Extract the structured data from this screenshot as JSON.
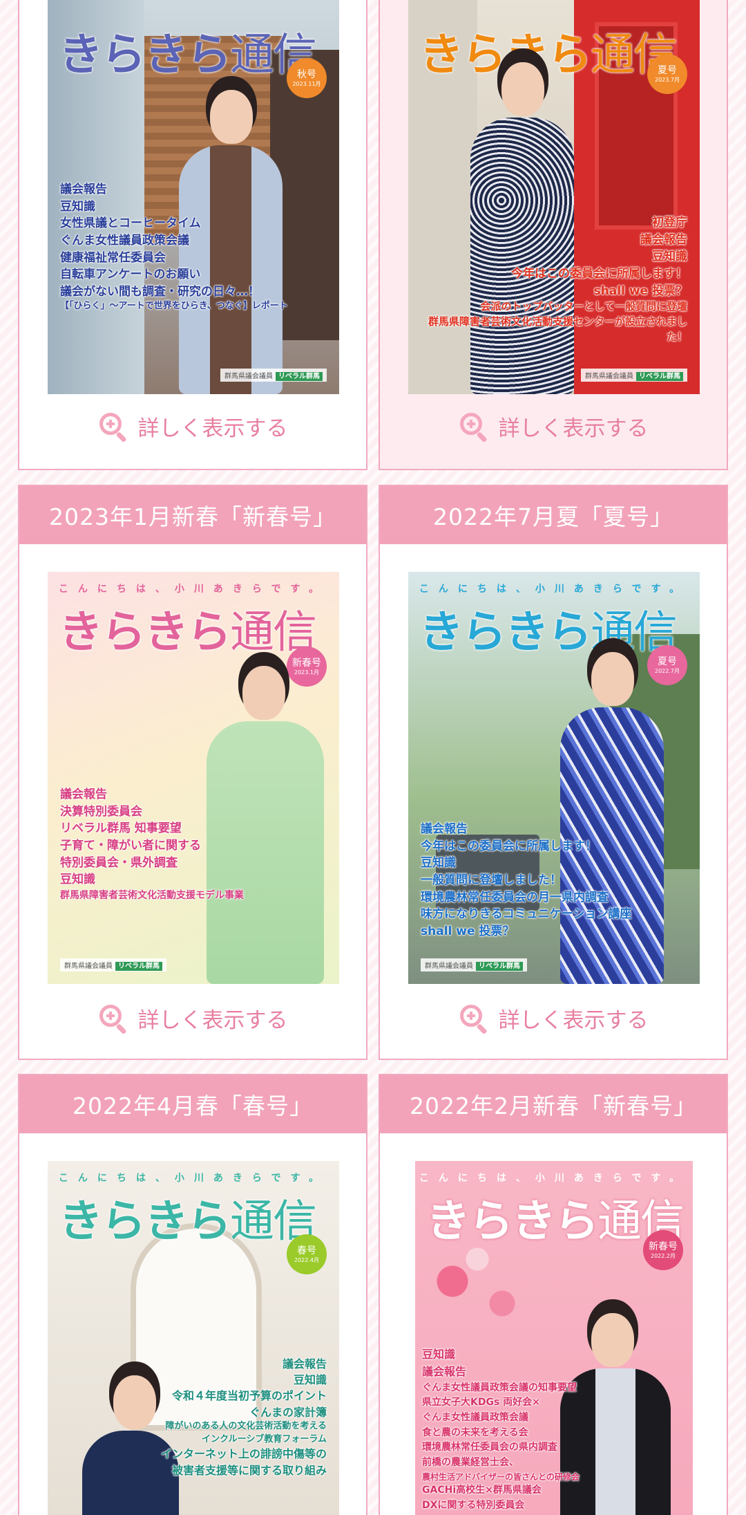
{
  "common": {
    "detail_label": "詳しく表示する",
    "series_top": "こんにちは、小川あきらです。",
    "brand_a": "きらきら",
    "brand_b": "通信",
    "footer_org": "群馬県議会議員",
    "footer_party": "リベラル群馬"
  },
  "colors": {
    "header_bg": "#f2a3ba",
    "card_border": "#f2a9c0",
    "link_text": "#e87fa0"
  },
  "issues": [
    {
      "title": "",
      "badge": "秋号",
      "badge_date": "2023.11月",
      "headlines": [
        "議会報告",
        "豆知識",
        "女性県議とコーヒータイム",
        "ぐんま女性議員政策会議",
        "健康福祉常任委員会",
        "自転車アンケートのお願い",
        "議会がない間も調査・研究の日々…！",
        "【「ひらく」〜アートで世界をひらき、つなぐ】レポート"
      ]
    },
    {
      "title": "",
      "badge": "夏号",
      "badge_date": "2023.7月",
      "headlines": [
        "初登庁",
        "議会報告",
        "豆知識",
        "今年はこの委員会に所属します！",
        "shall we 投票？",
        "会派のトップバッターとして一般質問に登壇",
        "群馬県障害者芸術文化活動支援センターが設立されました！"
      ]
    },
    {
      "title": "2023年1月新春「新春号」",
      "badge": "新春号",
      "badge_date": "2023.1月",
      "headlines": [
        "議会報告",
        "決算特別委員会",
        "リベラル群馬 知事要望",
        "子育て・障がい者に関する",
        "特別委員会・県外調査",
        "豆知識",
        "群馬県障害者芸術文化活動支援モデル事業"
      ]
    },
    {
      "title": "2022年7月夏「夏号」",
      "badge": "夏号",
      "badge_date": "2022.7月",
      "headlines": [
        "議会報告",
        "今年はこの委員会に所属します！",
        "豆知識",
        "一般質問に登壇しました！",
        "環境農林常任委員会の月一県内調査",
        "味方になりきるコミュニケーション講座",
        "shall we 投票？"
      ]
    },
    {
      "title": "2022年4月春「春号」",
      "badge": "春号",
      "badge_date": "2022.4月",
      "headlines": [
        "議会報告",
        "豆知識",
        "令和４年度当初予算のポイント",
        "ぐんまの家計簿",
        "障がいのある人の文化芸術活動を考える",
        "インクルーシブ教育フォーラム",
        "インターネット上の誹謗中傷等の",
        "被害者支援等に関する取り組み"
      ]
    },
    {
      "title": "2022年2月新春「新春号」",
      "badge": "新春号",
      "badge_date": "2022.2月",
      "headlines": [
        "豆知識",
        "議会報告",
        "ぐんま女性議員政策会議の知事要望",
        "県立女子大KDGs 両好会×",
        "ぐんま女性議員政策会議",
        "食と農の未来を考える会",
        "環境農林常任委員会の県内調査",
        "前橋の農業経営士会、",
        "農村生活アドバイザーの皆さんとの研修会",
        "GACHi高校生×群馬県議会",
        "DXに関する特別委員会"
      ]
    }
  ]
}
